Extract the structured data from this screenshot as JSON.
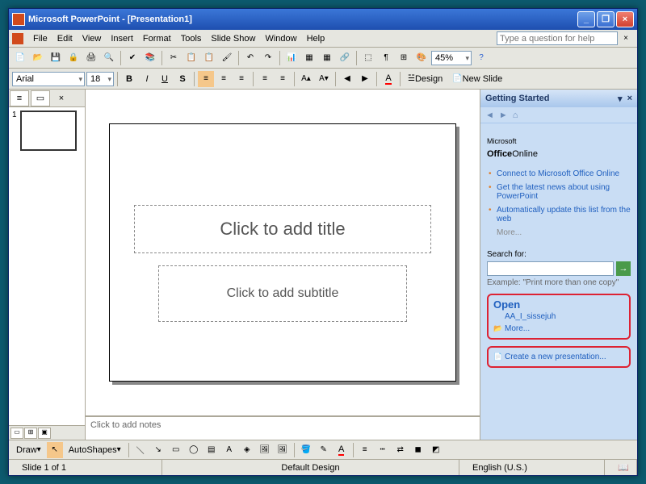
{
  "title": "Microsoft PowerPoint - [Presentation1]",
  "menus": [
    "File",
    "Edit",
    "View",
    "Insert",
    "Format",
    "Tools",
    "Slide Show",
    "Window",
    "Help"
  ],
  "help_placeholder": "Type a question for help",
  "font": {
    "name": "Arial",
    "size": "18"
  },
  "zoom": "45%",
  "design_btn": "Design",
  "newslide_btn": "New Slide",
  "slide": {
    "thumb_num": "1",
    "title_placeholder": "Click to add title",
    "subtitle_placeholder": "Click to add subtitle",
    "notes_placeholder": "Click to add notes"
  },
  "taskpane": {
    "header": "Getting Started",
    "logo_pre": "Microsoft",
    "logo_main": "Office",
    "logo_suf": "Online",
    "links": [
      "Connect to Microsoft Office Online",
      "Get the latest news about using PowerPoint",
      "Automatically update this list from the web"
    ],
    "more": "More...",
    "search_label": "Search for:",
    "example": "Example:  \"Print more than one copy\"",
    "open_title": "Open",
    "open_recent": "AA_I_sissejuh",
    "open_more": "More...",
    "create": "Create a new presentation..."
  },
  "draw": {
    "label": "Draw",
    "autoshapes": "AutoShapes"
  },
  "status": {
    "slide": "Slide 1 of 1",
    "design": "Default Design",
    "lang": "English (U.S.)"
  }
}
